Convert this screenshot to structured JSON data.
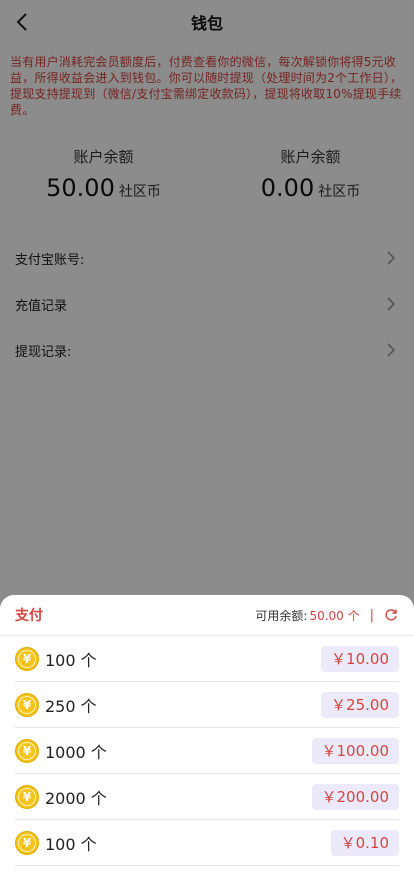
{
  "header": {
    "title": "钱包"
  },
  "notice": "当有用户消耗完会员额度后，付费查看你的微信，每次解锁你将得5元收益，所得收益会进入到钱包。你可以随时提现（处理时间为2个工作日），提现支持提现到（微信/支付宝需绑定收款码），提现将收取10%提现手续费。",
  "balances": [
    {
      "label": "账户余额",
      "amount": "50.00",
      "unit": "社区币"
    },
    {
      "label": "账户余额",
      "amount": "0.00",
      "unit": "社区币"
    }
  ],
  "rows": [
    {
      "label": "支付宝账号:"
    },
    {
      "label": "充值记录"
    },
    {
      "label": "提现记录:"
    }
  ],
  "sheet": {
    "title": "支付",
    "available_label": "可用余额:",
    "available_value": "50.00 个",
    "separator": "|",
    "packages": [
      {
        "qty": "100 个",
        "price": "￥10.00"
      },
      {
        "qty": "250 个",
        "price": "￥25.00"
      },
      {
        "qty": "1000 个",
        "price": "￥100.00"
      },
      {
        "qty": "2000 个",
        "price": "￥200.00"
      },
      {
        "qty": "100 个",
        "price": "￥0.10"
      }
    ],
    "coin_symbol": "¥"
  },
  "colors": {
    "accent": "#d4453f",
    "price_bg": "#ece9fb",
    "coin": "#f6c21c"
  }
}
